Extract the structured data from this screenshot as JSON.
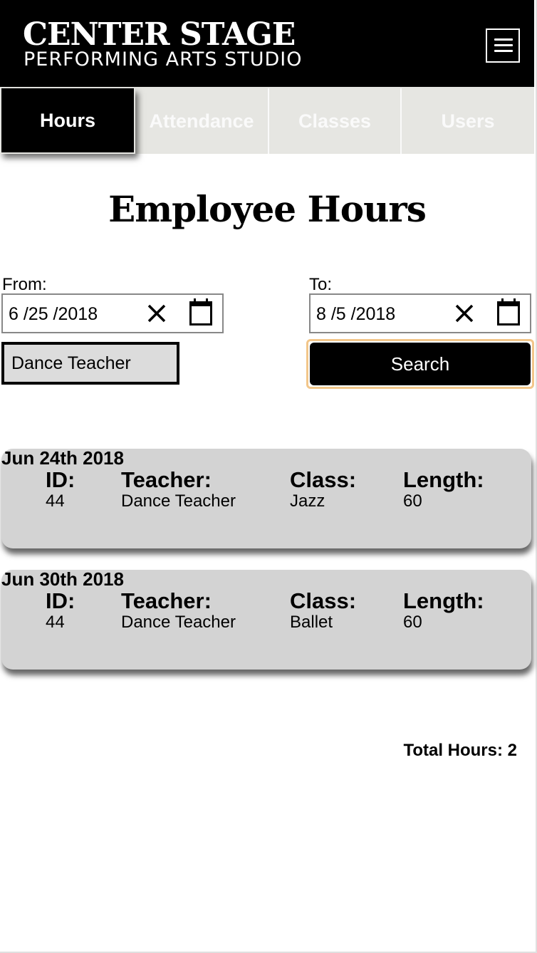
{
  "header": {
    "brand_main": "CENTER STAGE",
    "brand_sub": "PERFORMING ARTS STUDIO",
    "menu_icon": "hamburger-menu-icon"
  },
  "tabs": [
    {
      "label": "Hours",
      "active": true
    },
    {
      "label": "Attendance",
      "active": false
    },
    {
      "label": "Classes",
      "active": false
    },
    {
      "label": "Users",
      "active": false
    }
  ],
  "page_title": "Employee Hours",
  "filters": {
    "from_label": "From:",
    "from_value": "6 /25 /2018",
    "to_label": "To:",
    "to_value": "8 /5 /2018",
    "teacher_value": "Dance Teacher",
    "search_label": "Search"
  },
  "columns": {
    "id": "ID:",
    "teacher": "Teacher:",
    "class": "Class:",
    "length": "Length:"
  },
  "entries": [
    {
      "date": "Jun 24th 2018",
      "id": "44",
      "teacher": "Dance Teacher",
      "class": "Jazz",
      "length": "60"
    },
    {
      "date": "Jun 30th 2018",
      "id": "44",
      "teacher": "Dance Teacher",
      "class": "Ballet",
      "length": "60"
    }
  ],
  "total_hours": "Total Hours: 2",
  "colors": {
    "header_bg": "#000000",
    "tab_bar_bg": "#e6e6e2",
    "card_bg": "#d3d3d3",
    "focus_ring": "#f2c68a"
  }
}
